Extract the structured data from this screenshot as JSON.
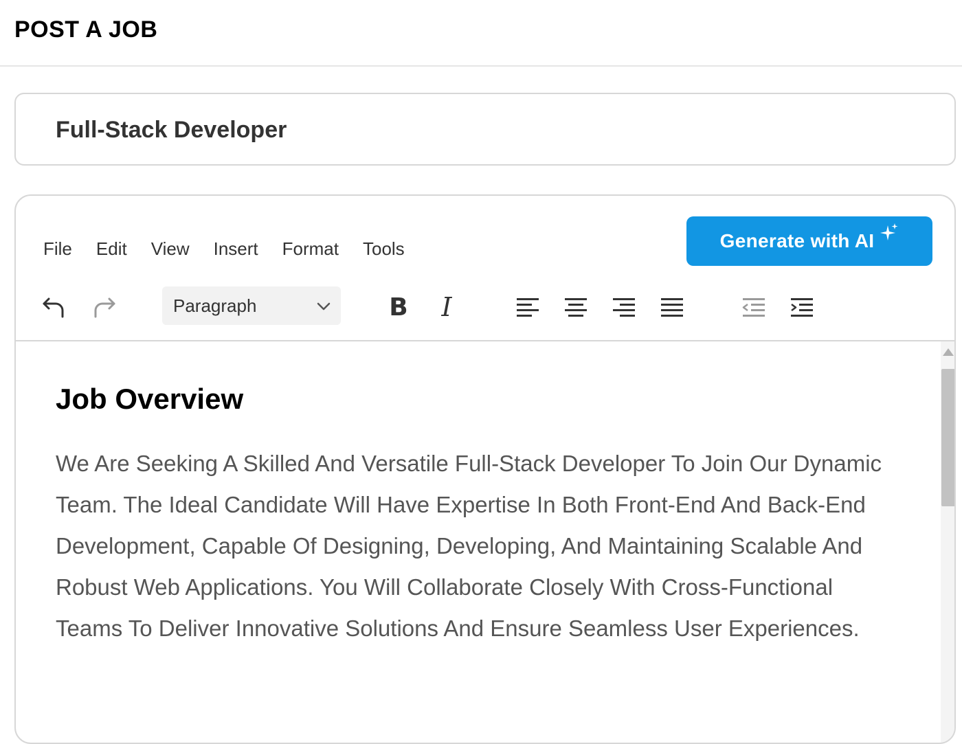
{
  "header": {
    "title": "POST A JOB"
  },
  "job_title": {
    "value": "Full-Stack Developer"
  },
  "editor": {
    "menu": [
      "File",
      "Edit",
      "View",
      "Insert",
      "Format",
      "Tools"
    ],
    "ai_button_label": "Generate with AI",
    "toolbar": {
      "block_format": "Paragraph",
      "bold_label": "B",
      "italic_label": "I",
      "icons": [
        "undo-icon",
        "redo-icon",
        "chevron-down-icon",
        "align-left-icon",
        "align-center-icon",
        "align-right-icon",
        "align-justify-icon",
        "outdent-icon",
        "indent-icon",
        "sparkle-icon"
      ]
    },
    "content": {
      "heading": "Job Overview",
      "body": "We Are Seeking A Skilled And Versatile Full-Stack Developer To Join Our Dynamic Team. The Ideal Candidate Will Have Expertise In Both Front-End And Back-End Development, Capable Of Designing, Developing, And Maintaining Scalable And Robust Web Applications. You Will Collaborate Closely With Cross-Functional Teams To Deliver Innovative Solutions And Ensure Seamless User Experiences."
    }
  },
  "colors": {
    "accent": "#1296e3",
    "border": "#d7d7d7",
    "text_primary": "#000000",
    "text_body": "#555555"
  }
}
